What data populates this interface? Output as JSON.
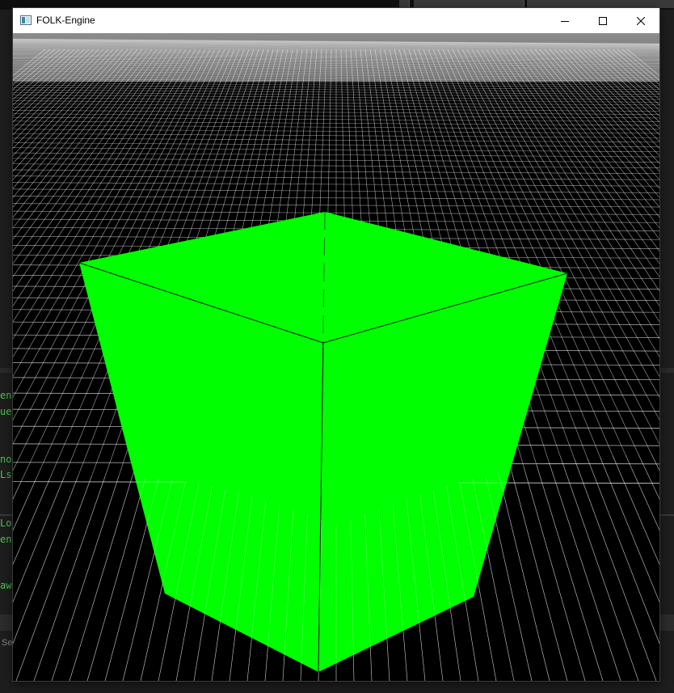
{
  "window": {
    "title": "FOLK-Engine",
    "minimize_icon": "minimize-icon",
    "maximize_icon": "maximize-icon",
    "close_icon": "close-icon"
  },
  "background": {
    "console_fragments": [
      "ent",
      "ue",
      "nos",
      "Lsc",
      "Lop",
      "en",
      "aw("
    ],
    "status_fragment": "Se"
  },
  "scene": {
    "cube_color": "#00ff00",
    "edge_color": "#1a1a1a",
    "sky_color": "#8c8c8c",
    "grid_color": "#ffffff",
    "ground_color": "#000000"
  }
}
